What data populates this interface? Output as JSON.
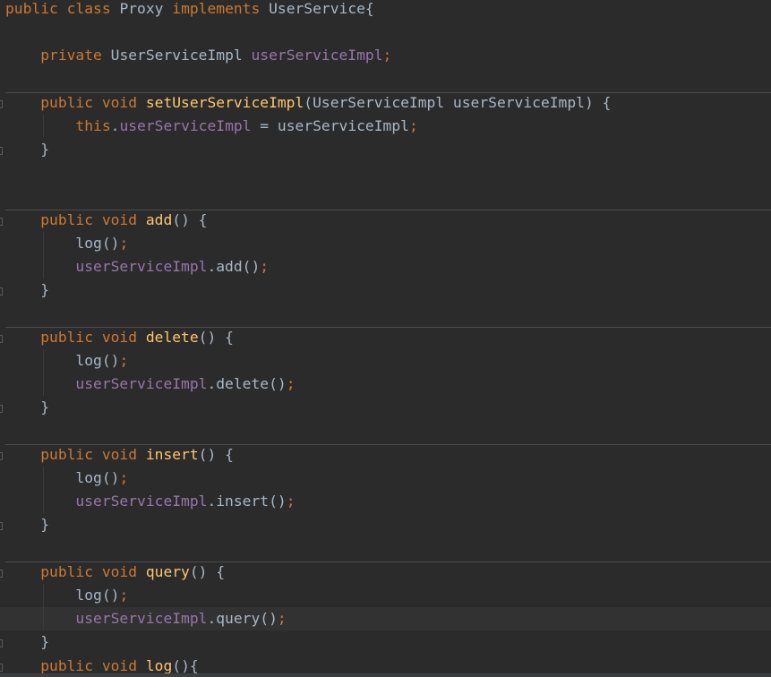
{
  "theme": {
    "background": "#2b2b2b",
    "current_line": "#323232",
    "keyword_color": "#cc7832",
    "method_color": "#ffc66d",
    "field_color": "#9876aa",
    "text_color": "#a9b7c6"
  },
  "code": {
    "language": "java",
    "lines": [
      [
        {
          "t": "public class ",
          "c": "kw"
        },
        {
          "t": "Proxy ",
          "c": "pl"
        },
        {
          "t": "implements ",
          "c": "kw"
        },
        {
          "t": "UserService{",
          "c": "pl"
        }
      ],
      [],
      [
        {
          "t": "    private ",
          "c": "kw"
        },
        {
          "t": "UserServiceImpl ",
          "c": "pl"
        },
        {
          "t": "userServiceImpl",
          "c": "fld"
        },
        {
          "t": ";",
          "c": "kw"
        }
      ],
      [],
      [
        {
          "t": "    public void ",
          "c": "kw"
        },
        {
          "t": "setUserServiceImpl",
          "c": "fn"
        },
        {
          "t": "(UserServiceImpl userServiceImpl) {",
          "c": "pl"
        }
      ],
      [
        {
          "t": "        this",
          "c": "kw"
        },
        {
          "t": ".",
          "c": "pl"
        },
        {
          "t": "userServiceImpl",
          "c": "fld"
        },
        {
          "t": " = userServiceImpl",
          "c": "pl"
        },
        {
          "t": ";",
          "c": "kw"
        }
      ],
      [
        {
          "t": "    }",
          "c": "pl"
        }
      ],
      [],
      [],
      [
        {
          "t": "    public void ",
          "c": "kw"
        },
        {
          "t": "add",
          "c": "fn"
        },
        {
          "t": "() {",
          "c": "pl"
        }
      ],
      [
        {
          "t": "        log()",
          "c": "pl"
        },
        {
          "t": ";",
          "c": "kw"
        }
      ],
      [
        {
          "t": "        userServiceImpl",
          "c": "fld"
        },
        {
          "t": ".add()",
          "c": "pl"
        },
        {
          "t": ";",
          "c": "kw"
        }
      ],
      [
        {
          "t": "    }",
          "c": "pl"
        }
      ],
      [],
      [
        {
          "t": "    public void ",
          "c": "kw"
        },
        {
          "t": "delete",
          "c": "fn"
        },
        {
          "t": "() {",
          "c": "pl"
        }
      ],
      [
        {
          "t": "        log()",
          "c": "pl"
        },
        {
          "t": ";",
          "c": "kw"
        }
      ],
      [
        {
          "t": "        userServiceImpl",
          "c": "fld"
        },
        {
          "t": ".delete()",
          "c": "pl"
        },
        {
          "t": ";",
          "c": "kw"
        }
      ],
      [
        {
          "t": "    }",
          "c": "pl"
        }
      ],
      [],
      [
        {
          "t": "    public void ",
          "c": "kw"
        },
        {
          "t": "insert",
          "c": "fn"
        },
        {
          "t": "() {",
          "c": "pl"
        }
      ],
      [
        {
          "t": "        log()",
          "c": "pl"
        },
        {
          "t": ";",
          "c": "kw"
        }
      ],
      [
        {
          "t": "        userServiceImpl",
          "c": "fld"
        },
        {
          "t": ".insert()",
          "c": "pl"
        },
        {
          "t": ";",
          "c": "kw"
        }
      ],
      [
        {
          "t": "    }",
          "c": "pl"
        }
      ],
      [],
      [
        {
          "t": "    public void ",
          "c": "kw"
        },
        {
          "t": "query",
          "c": "fn"
        },
        {
          "t": "() {",
          "c": "pl"
        }
      ],
      [
        {
          "t": "        log()",
          "c": "pl"
        },
        {
          "t": ";",
          "c": "kw"
        }
      ],
      [
        {
          "t": "        userServiceImpl",
          "c": "fld"
        },
        {
          "t": ".query()",
          "c": "pl"
        },
        {
          "t": ";",
          "c": "kw"
        }
      ],
      [
        {
          "t": "    }",
          "c": "pl"
        }
      ],
      [
        {
          "t": "    public void ",
          "c": "kw"
        },
        {
          "t": "log",
          "c": "fn"
        },
        {
          "t": "(){",
          "c": "pl"
        }
      ]
    ],
    "current_line_index": 26,
    "separator_before_lines": [
      4,
      9,
      14,
      19,
      24
    ],
    "fold_marker_lines": [
      4,
      6,
      9,
      12,
      14,
      17,
      19,
      22,
      24,
      27,
      28
    ]
  }
}
